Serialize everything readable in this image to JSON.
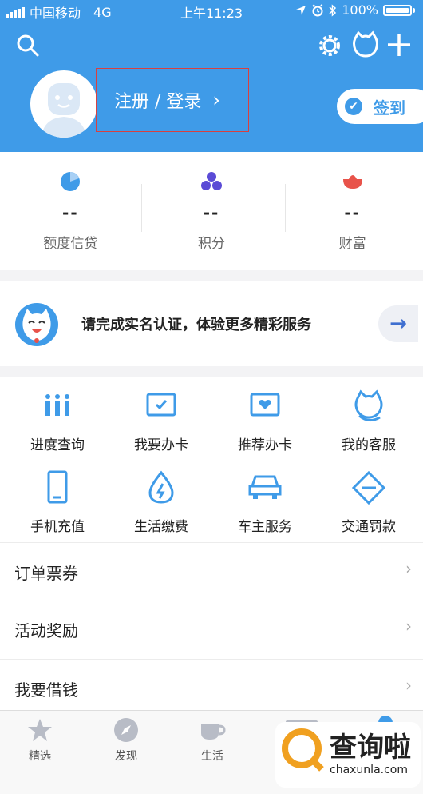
{
  "status_bar": {
    "carrier": "中国移动",
    "network": "4G",
    "time": "上午11:23",
    "battery": "100%"
  },
  "header": {
    "login_label": "注册 / 登录",
    "login_chevron": "›",
    "checkin_label": "签到",
    "icons": [
      "search-icon",
      "settings-icon",
      "cat-mascot-icon",
      "plus-icon"
    ],
    "background": "#3f9be8"
  },
  "stats": [
    {
      "value": "--",
      "label": "额度信贷",
      "icon": "pie-icon",
      "color": "#3f9be8"
    },
    {
      "value": "--",
      "label": "积分",
      "icon": "dots-icon",
      "color": "#5b4bd6"
    },
    {
      "value": "--",
      "label": "财富",
      "icon": "bowl-icon",
      "color": "#e8534a"
    }
  ],
  "verify_banner": {
    "text": "请完成实名认证，体验更多精彩服务",
    "arrow": "→"
  },
  "services": [
    {
      "label": "进度查询",
      "icon": "progress-icon"
    },
    {
      "label": "我要办卡",
      "icon": "card-apply-icon"
    },
    {
      "label": "推荐办卡",
      "icon": "card-recommend-icon"
    },
    {
      "label": "我的客服",
      "icon": "customer-service-icon"
    },
    {
      "label": "手机充值",
      "icon": "phone-icon"
    },
    {
      "label": "生活缴费",
      "icon": "water-drop-icon"
    },
    {
      "label": "车主服务",
      "icon": "car-icon"
    },
    {
      "label": "交通罚款",
      "icon": "traffic-sign-icon"
    }
  ],
  "menu_rows": [
    {
      "label": "订单票券",
      "chevron": "›"
    },
    {
      "label": "活动奖励",
      "chevron": "›"
    },
    {
      "label": "我要借钱",
      "chevron": "›"
    }
  ],
  "tabbar": [
    {
      "label": "精选",
      "icon": "star-icon"
    },
    {
      "label": "发现",
      "icon": "compass-icon"
    },
    {
      "label": "生活",
      "icon": "cup-icon"
    }
  ],
  "watermark": {
    "title": "查询啦",
    "url": "chaxunla.com"
  }
}
